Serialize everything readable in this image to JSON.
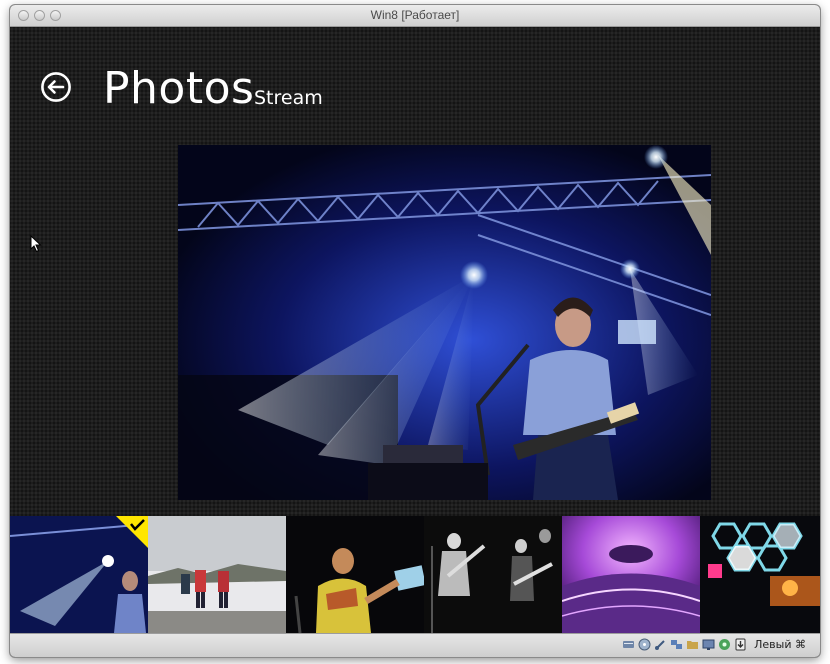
{
  "window": {
    "title": "Win8 [Работает]"
  },
  "app": {
    "title": "Photos",
    "subtitle": "Stream"
  },
  "thumbnails": [
    {
      "name": "thumb-concert-blue",
      "selected": true
    },
    {
      "name": "thumb-snow-people",
      "selected": false
    },
    {
      "name": "thumb-singer-color",
      "selected": false
    },
    {
      "name": "thumb-band-bw",
      "selected": false
    },
    {
      "name": "thumb-purple-dome",
      "selected": false
    },
    {
      "name": "thumb-hexagon-lights",
      "selected": false
    }
  ],
  "statusbar": {
    "icons": [
      "hdd-icon",
      "cd-icon",
      "usb-icon",
      "network-icon",
      "shared-folder-icon",
      "display-icon",
      "video-capture-icon",
      "mouse-integration-icon"
    ],
    "host_key": "Левый ⌘"
  },
  "colors": {
    "accent_check": "#ffe600",
    "screen_bg": "#1d1d1d"
  }
}
